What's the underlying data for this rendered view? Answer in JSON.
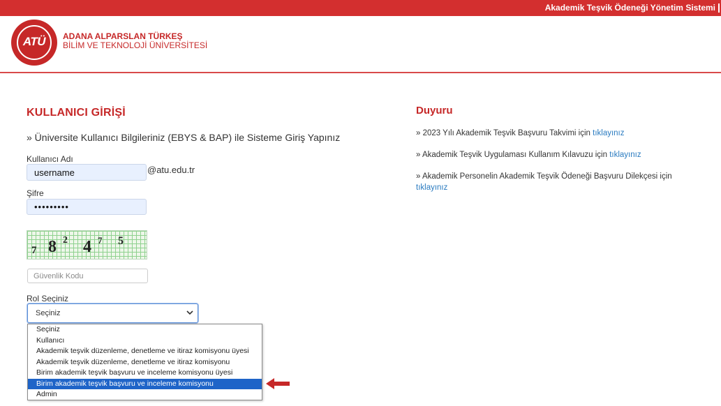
{
  "topbar": {
    "title": "Akademik Teşvik Ödeneği Yönetim Sistemi"
  },
  "header": {
    "logo_text": "ATÜ",
    "university_line1": "ADANA ALPARSLAN TÜRKEŞ",
    "university_line2": "BİLİM VE TEKNOLOJİ ÜNİVERSİTESİ"
  },
  "colors": {
    "brand": "#d32f2f",
    "link": "#2a7bc0",
    "selected": "#1e64c8",
    "arrow": "#c62828"
  },
  "login": {
    "title": "KULLANICI GİRİŞİ",
    "subtitle": "» Üniversite Kullanıcı Bilgileriniz (EBYS & BAP) ile Sisteme Giriş Yapınız",
    "username_label": "Kullanıcı Adı",
    "username_value": "username",
    "domain_suffix": "@atu.edu.tr",
    "password_label": "Şifre",
    "password_value": "•••••••••",
    "captcha_chars": [
      "7",
      "8",
      "2",
      "4",
      "7",
      "5"
    ],
    "security_placeholder": "Güvenlik Kodu",
    "role_label": "Rol Seçiniz",
    "role_selected": "Seçiniz",
    "role_options": [
      "Seçiniz",
      "Kullanıcı",
      "Akademik teşvik düzenleme, denetleme ve itiraz komisyonu üyesi",
      "Akademik teşvik düzenleme, denetleme ve itiraz komisyonu",
      "Birim akademik teşvik başvuru ve inceleme komisyonu üyesi",
      "Birim akademik teşvik başvuru ve inceleme komisyonu",
      "Admin"
    ],
    "highlighted_option_index": 5
  },
  "duyuru": {
    "title": "Duyuru",
    "items": [
      {
        "text": "» 2023 Yılı Akademik Teşvik Başvuru Takvimi için ",
        "link": "tıklayınız"
      },
      {
        "text": "» Akademik Teşvik Uygulaması Kullanım Kılavuzu için ",
        "link": "tıklayınız"
      },
      {
        "text": "» Akademik Personelin Akademik Teşvik Ödeneği Başvuru Dilekçesi için ",
        "link": "tıklayınız"
      }
    ]
  }
}
